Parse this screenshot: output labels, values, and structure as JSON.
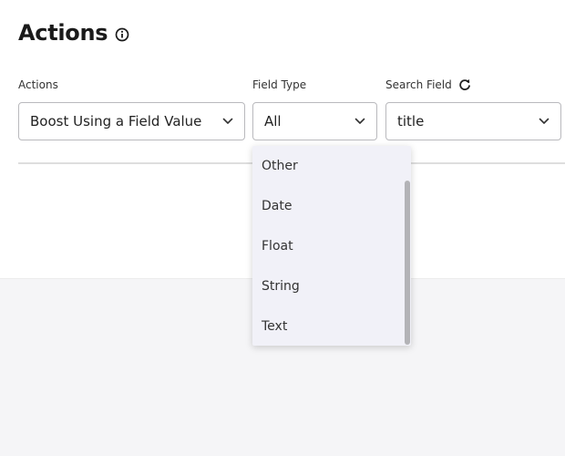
{
  "header": {
    "title": "Actions",
    "info_icon": "info-circle-icon"
  },
  "fields": {
    "actions": {
      "label": "Actions",
      "value": "Boost Using a Field Value"
    },
    "field_type": {
      "label": "Field Type",
      "value": "All"
    },
    "search_field": {
      "label": "Search Field",
      "value": "title",
      "refresh_icon": "refresh-icon"
    }
  },
  "field_type_dropdown": {
    "options": [
      "Other",
      "Date",
      "Float",
      "String",
      "Text"
    ]
  },
  "colors": {
    "panel_bg": "#ffffff",
    "page_bg": "#f5f5f7",
    "dropdown_bg": "#f1f1f8",
    "border": "#b9b9bd"
  }
}
